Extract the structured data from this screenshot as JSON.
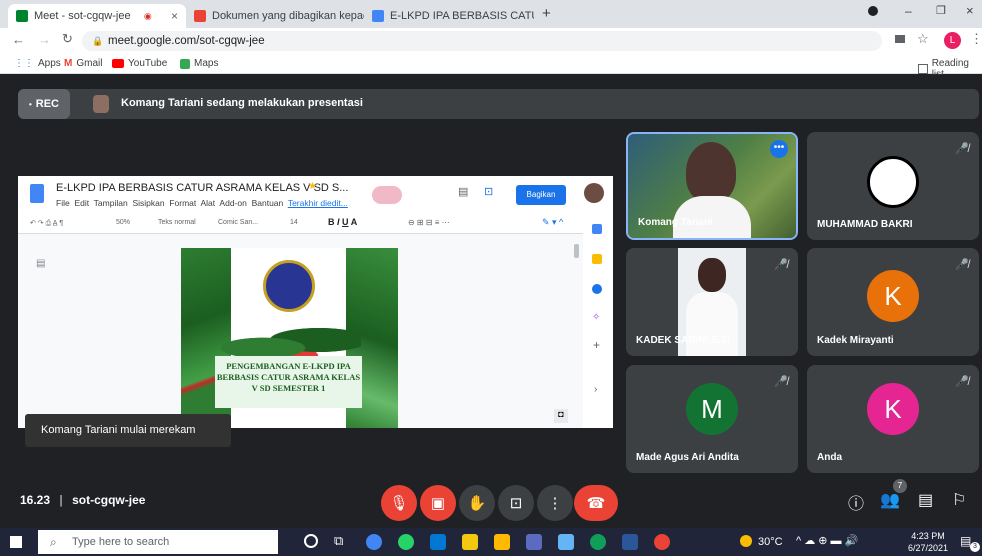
{
  "browser": {
    "tabs": [
      {
        "title": "Meet - sot-cgqw-jee",
        "active": true
      },
      {
        "title": "Dokumen yang dibagikan kepad",
        "active": false
      },
      {
        "title": "E-LKPD IPA BERBASIS CATUR ASR",
        "active": false
      }
    ],
    "url": "meet.google.com/sot-cgqw-jee",
    "profile_initial": "L",
    "bookmarks": [
      "Apps",
      "Gmail",
      "YouTube",
      "Maps"
    ],
    "reading_list": "Reading list"
  },
  "meet": {
    "rec_label": "REC",
    "presenting_text": "Komang Tariani sedang melakukan presentasi",
    "toast": "Komang Tariani mulai merekam",
    "time": "16.23",
    "meeting_code": "sot-cgqw-jee",
    "people_count": "7",
    "participants": [
      {
        "name": "Komang Tariani",
        "kind": "video",
        "muted": false
      },
      {
        "name": "MUHAMMAD BAKRI",
        "kind": "image",
        "muted": true
      },
      {
        "name": "KADEK SARINI,S.Si",
        "kind": "video",
        "muted": true
      },
      {
        "name": "Kadek Mirayanti",
        "kind": "avatar",
        "initial": "K",
        "color": "#e8710a",
        "muted": true
      },
      {
        "name": "Made Agus Ari Andita",
        "kind": "avatar",
        "initial": "M",
        "color": "#137333",
        "muted": true
      },
      {
        "name": "Anda",
        "kind": "avatar",
        "initial": "K",
        "color": "#e52592",
        "muted": true
      }
    ]
  },
  "doc": {
    "title": "E-LKPD IPA BERBASIS CATUR ASRAMA KELAS V SD S...",
    "menu": [
      "File",
      "Edit",
      "Tampilan",
      "Sisipkan",
      "Format",
      "Alat",
      "Add-on",
      "Bantuan",
      "Terakhir diedit..."
    ],
    "share_label": "Bagikan",
    "zoom": "50%",
    "style": "Teks normal",
    "font": "Comic San...",
    "font_size": "14",
    "cover_title": "PENGEMBANGAN E-LKPD IPA BERBASIS CATUR ASRAMA KELAS V SD SEMESTER 1"
  },
  "taskbar": {
    "search_placeholder": "Type here to search",
    "weather": "30°C",
    "time": "4:23 PM",
    "date": "6/27/2021",
    "notification_count": "3"
  }
}
